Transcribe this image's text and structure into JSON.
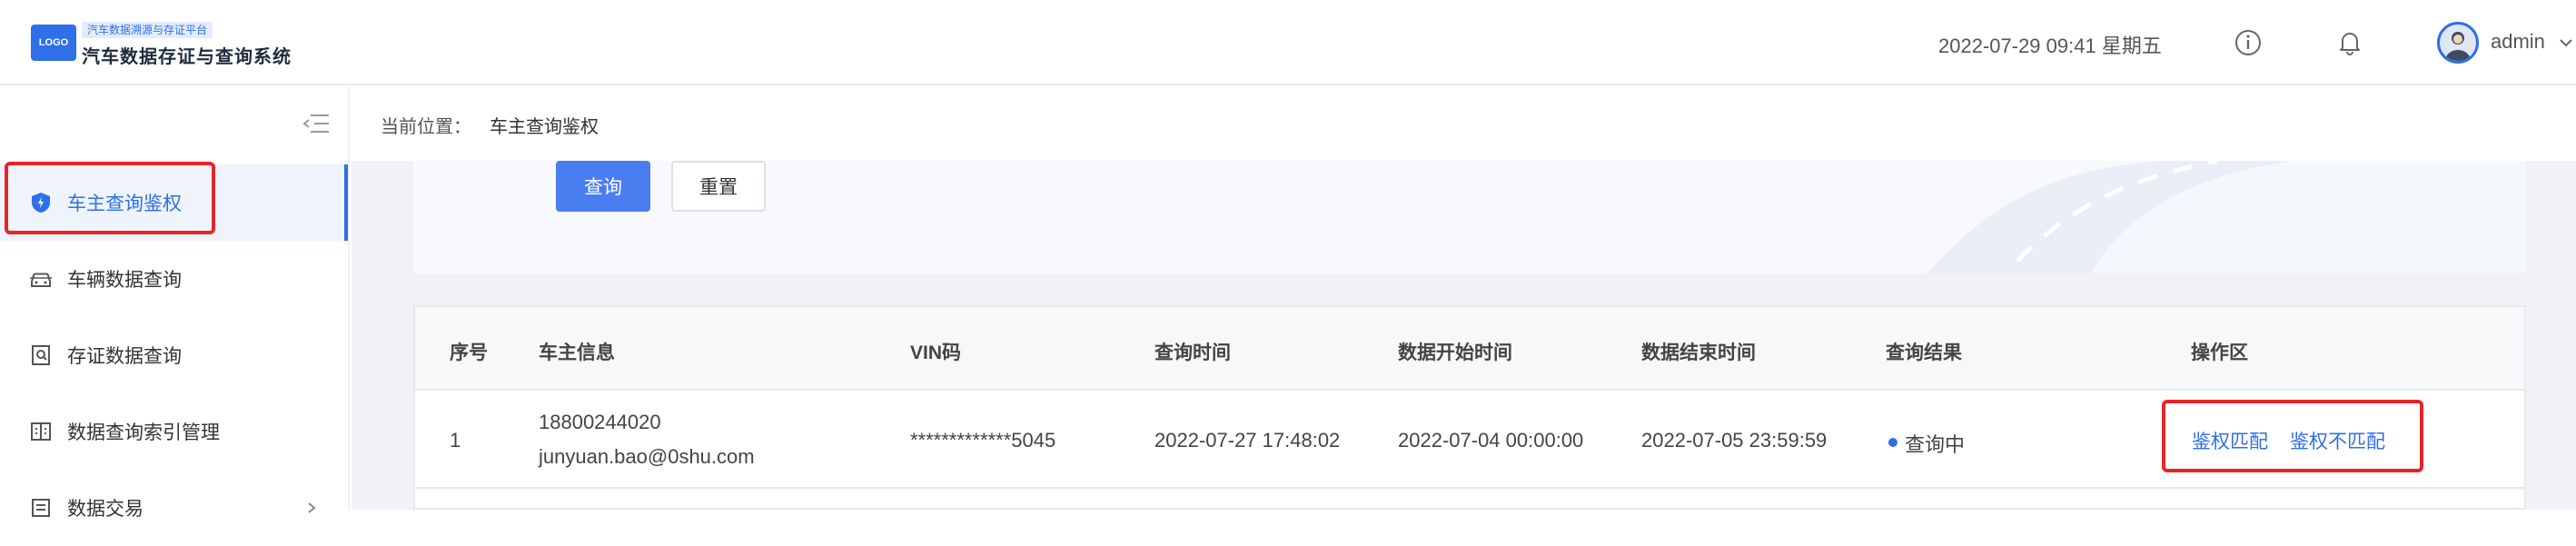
{
  "header": {
    "logo_text": "LOGO",
    "subtitle": "汽车数据溯源与存证平台",
    "title": "汽车数据存证与查询系统",
    "datetime": "2022-07-29 09:41 星期五",
    "info_icon": "info-circle-icon",
    "bell_icon": "bell-icon",
    "user": "admin"
  },
  "sidebar": {
    "items": [
      {
        "label": "车主查询鉴权",
        "icon": "shield-icon",
        "active": true
      },
      {
        "label": "车辆数据查询",
        "icon": "car-icon",
        "active": false
      },
      {
        "label": "存证数据查询",
        "icon": "search-doc-icon",
        "active": false
      },
      {
        "label": "数据查询索引管理",
        "icon": "index-icon",
        "active": false
      },
      {
        "label": "数据交易",
        "icon": "list-icon",
        "active": false
      }
    ]
  },
  "breadcrumb": {
    "label": "当前位置：",
    "current": "车主查询鉴权"
  },
  "filter": {
    "query_label": "查询",
    "reset_label": "重置"
  },
  "table": {
    "columns": [
      "序号",
      "车主信息",
      "VIN码",
      "查询时间",
      "数据开始时间",
      "数据结束时间",
      "查询结果",
      "操作区"
    ],
    "rows": [
      {
        "index": "1",
        "owner_phone": "18800244020",
        "owner_email": "junyuan.bao@0shu.com",
        "vin": "*************5045",
        "query_time": "2022-07-27 17:48:02",
        "start_time": "2022-07-04 00:00:00",
        "end_time": "2022-07-05 23:59:59",
        "status": "查询中",
        "action_match": "鉴权匹配",
        "action_mismatch": "鉴权不匹配"
      }
    ]
  },
  "colors": {
    "accent": "#2f6fe8",
    "highlight": "#e8232a"
  }
}
